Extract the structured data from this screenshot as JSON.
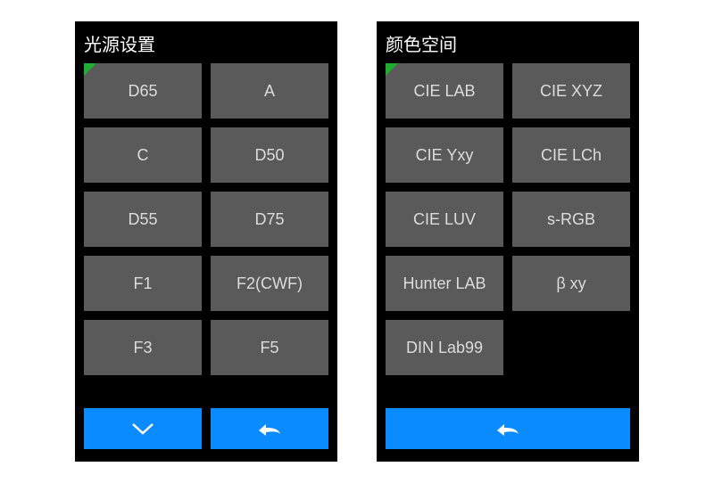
{
  "panels": [
    {
      "title": "光源设置",
      "options": [
        "D65",
        "A",
        "C",
        "D50",
        "D55",
        "D75",
        "F1",
        "F2(CWF)",
        "F3",
        "F5"
      ],
      "footer": [
        "down",
        "back"
      ]
    },
    {
      "title": "颜色空间",
      "options": [
        "CIE LAB",
        "CIE XYZ",
        "CIE Yxy",
        "CIE LCh",
        "CIE LUV",
        "s-RGB",
        "Hunter LAB",
        "β xy",
        "DIN Lab99",
        ""
      ],
      "footer": [
        "back-full"
      ]
    }
  ],
  "colors": {
    "accent": "#0a8bff",
    "cell": "#5a5a5a",
    "indicator": "#1fae2f"
  }
}
